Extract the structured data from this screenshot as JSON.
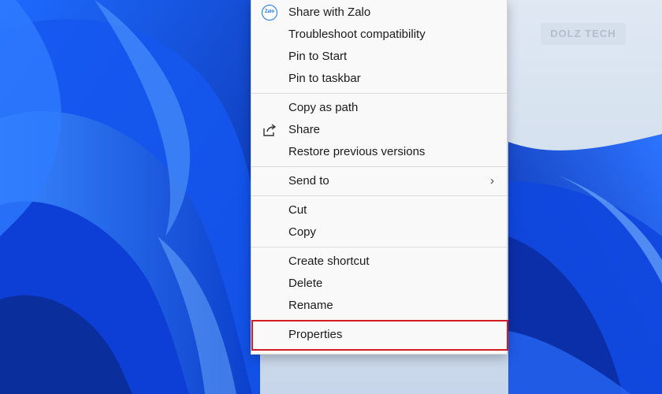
{
  "watermark": {
    "text": "DOLZ TECH"
  },
  "context_menu": {
    "groups": [
      {
        "items": [
          {
            "label": "Share with Zalo",
            "icon": "zalo-icon",
            "icon_text": "Zalo"
          },
          {
            "label": "Troubleshoot compatibility"
          },
          {
            "label": "Pin to Start"
          },
          {
            "label": "Pin to taskbar"
          }
        ]
      },
      {
        "items": [
          {
            "label": "Copy as path"
          },
          {
            "label": "Share",
            "icon": "share-icon"
          },
          {
            "label": "Restore previous versions"
          }
        ]
      },
      {
        "items": [
          {
            "label": "Send to",
            "submenu": true,
            "chevron": "›"
          }
        ]
      },
      {
        "items": [
          {
            "label": "Cut"
          },
          {
            "label": "Copy"
          }
        ]
      },
      {
        "items": [
          {
            "label": "Create shortcut"
          },
          {
            "label": "Delete"
          },
          {
            "label": "Rename"
          }
        ]
      },
      {
        "items": [
          {
            "label": "Properties",
            "highlighted": true
          }
        ]
      }
    ]
  },
  "colors": {
    "highlight_border": "#d21d26",
    "menu_background": "#f9f9f9",
    "wallpaper_blue": "#0a3fc8"
  }
}
